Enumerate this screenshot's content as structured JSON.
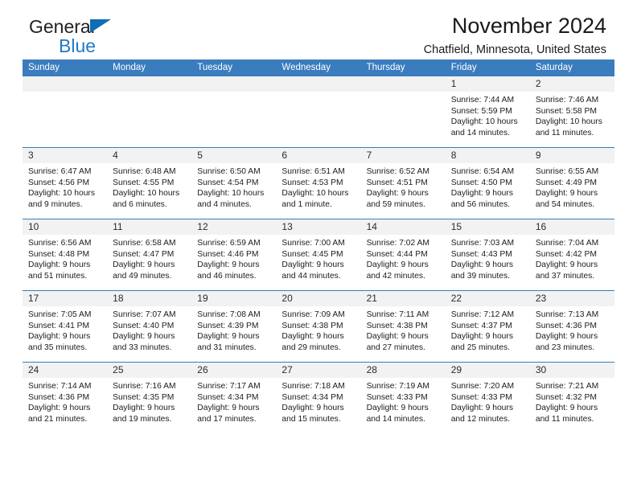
{
  "brand": {
    "name_top": "General",
    "name_bottom": "Blue",
    "accent_color": "#1f7ac4"
  },
  "header": {
    "title": "November 2024",
    "subtitle": "Chatfield, Minnesota, United States"
  },
  "calendar": {
    "header_bg": "#3a7cbe",
    "daynum_bg": "#f2f2f2",
    "weekday_headers": [
      "Sunday",
      "Monday",
      "Tuesday",
      "Wednesday",
      "Thursday",
      "Friday",
      "Saturday"
    ],
    "weeks": [
      [
        {
          "blank": true
        },
        {
          "blank": true
        },
        {
          "blank": true
        },
        {
          "blank": true
        },
        {
          "blank": true
        },
        {
          "day": "1",
          "sunrise": "Sunrise: 7:44 AM",
          "sunset": "Sunset: 5:59 PM",
          "daylight": "Daylight: 10 hours and 14 minutes."
        },
        {
          "day": "2",
          "sunrise": "Sunrise: 7:46 AM",
          "sunset": "Sunset: 5:58 PM",
          "daylight": "Daylight: 10 hours and 11 minutes."
        }
      ],
      [
        {
          "day": "3",
          "sunrise": "Sunrise: 6:47 AM",
          "sunset": "Sunset: 4:56 PM",
          "daylight": "Daylight: 10 hours and 9 minutes."
        },
        {
          "day": "4",
          "sunrise": "Sunrise: 6:48 AM",
          "sunset": "Sunset: 4:55 PM",
          "daylight": "Daylight: 10 hours and 6 minutes."
        },
        {
          "day": "5",
          "sunrise": "Sunrise: 6:50 AM",
          "sunset": "Sunset: 4:54 PM",
          "daylight": "Daylight: 10 hours and 4 minutes."
        },
        {
          "day": "6",
          "sunrise": "Sunrise: 6:51 AM",
          "sunset": "Sunset: 4:53 PM",
          "daylight": "Daylight: 10 hours and 1 minute."
        },
        {
          "day": "7",
          "sunrise": "Sunrise: 6:52 AM",
          "sunset": "Sunset: 4:51 PM",
          "daylight": "Daylight: 9 hours and 59 minutes."
        },
        {
          "day": "8",
          "sunrise": "Sunrise: 6:54 AM",
          "sunset": "Sunset: 4:50 PM",
          "daylight": "Daylight: 9 hours and 56 minutes."
        },
        {
          "day": "9",
          "sunrise": "Sunrise: 6:55 AM",
          "sunset": "Sunset: 4:49 PM",
          "daylight": "Daylight: 9 hours and 54 minutes."
        }
      ],
      [
        {
          "day": "10",
          "sunrise": "Sunrise: 6:56 AM",
          "sunset": "Sunset: 4:48 PM",
          "daylight": "Daylight: 9 hours and 51 minutes."
        },
        {
          "day": "11",
          "sunrise": "Sunrise: 6:58 AM",
          "sunset": "Sunset: 4:47 PM",
          "daylight": "Daylight: 9 hours and 49 minutes."
        },
        {
          "day": "12",
          "sunrise": "Sunrise: 6:59 AM",
          "sunset": "Sunset: 4:46 PM",
          "daylight": "Daylight: 9 hours and 46 minutes."
        },
        {
          "day": "13",
          "sunrise": "Sunrise: 7:00 AM",
          "sunset": "Sunset: 4:45 PM",
          "daylight": "Daylight: 9 hours and 44 minutes."
        },
        {
          "day": "14",
          "sunrise": "Sunrise: 7:02 AM",
          "sunset": "Sunset: 4:44 PM",
          "daylight": "Daylight: 9 hours and 42 minutes."
        },
        {
          "day": "15",
          "sunrise": "Sunrise: 7:03 AM",
          "sunset": "Sunset: 4:43 PM",
          "daylight": "Daylight: 9 hours and 39 minutes."
        },
        {
          "day": "16",
          "sunrise": "Sunrise: 7:04 AM",
          "sunset": "Sunset: 4:42 PM",
          "daylight": "Daylight: 9 hours and 37 minutes."
        }
      ],
      [
        {
          "day": "17",
          "sunrise": "Sunrise: 7:05 AM",
          "sunset": "Sunset: 4:41 PM",
          "daylight": "Daylight: 9 hours and 35 minutes."
        },
        {
          "day": "18",
          "sunrise": "Sunrise: 7:07 AM",
          "sunset": "Sunset: 4:40 PM",
          "daylight": "Daylight: 9 hours and 33 minutes."
        },
        {
          "day": "19",
          "sunrise": "Sunrise: 7:08 AM",
          "sunset": "Sunset: 4:39 PM",
          "daylight": "Daylight: 9 hours and 31 minutes."
        },
        {
          "day": "20",
          "sunrise": "Sunrise: 7:09 AM",
          "sunset": "Sunset: 4:38 PM",
          "daylight": "Daylight: 9 hours and 29 minutes."
        },
        {
          "day": "21",
          "sunrise": "Sunrise: 7:11 AM",
          "sunset": "Sunset: 4:38 PM",
          "daylight": "Daylight: 9 hours and 27 minutes."
        },
        {
          "day": "22",
          "sunrise": "Sunrise: 7:12 AM",
          "sunset": "Sunset: 4:37 PM",
          "daylight": "Daylight: 9 hours and 25 minutes."
        },
        {
          "day": "23",
          "sunrise": "Sunrise: 7:13 AM",
          "sunset": "Sunset: 4:36 PM",
          "daylight": "Daylight: 9 hours and 23 minutes."
        }
      ],
      [
        {
          "day": "24",
          "sunrise": "Sunrise: 7:14 AM",
          "sunset": "Sunset: 4:36 PM",
          "daylight": "Daylight: 9 hours and 21 minutes."
        },
        {
          "day": "25",
          "sunrise": "Sunrise: 7:16 AM",
          "sunset": "Sunset: 4:35 PM",
          "daylight": "Daylight: 9 hours and 19 minutes."
        },
        {
          "day": "26",
          "sunrise": "Sunrise: 7:17 AM",
          "sunset": "Sunset: 4:34 PM",
          "daylight": "Daylight: 9 hours and 17 minutes."
        },
        {
          "day": "27",
          "sunrise": "Sunrise: 7:18 AM",
          "sunset": "Sunset: 4:34 PM",
          "daylight": "Daylight: 9 hours and 15 minutes."
        },
        {
          "day": "28",
          "sunrise": "Sunrise: 7:19 AM",
          "sunset": "Sunset: 4:33 PM",
          "daylight": "Daylight: 9 hours and 14 minutes."
        },
        {
          "day": "29",
          "sunrise": "Sunrise: 7:20 AM",
          "sunset": "Sunset: 4:33 PM",
          "daylight": "Daylight: 9 hours and 12 minutes."
        },
        {
          "day": "30",
          "sunrise": "Sunrise: 7:21 AM",
          "sunset": "Sunset: 4:32 PM",
          "daylight": "Daylight: 9 hours and 11 minutes."
        }
      ]
    ]
  }
}
